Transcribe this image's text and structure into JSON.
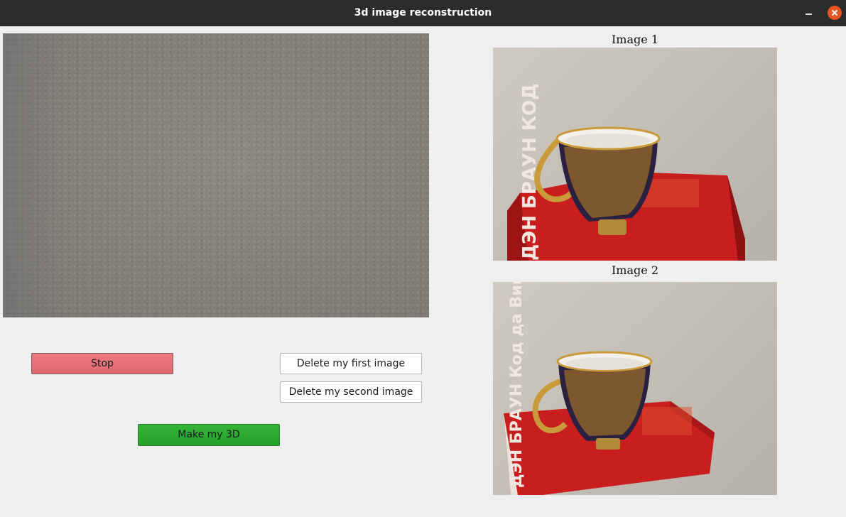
{
  "window": {
    "title": "3d image reconstruction"
  },
  "controls": {
    "stop_label": "Stop",
    "delete_first_label": "Delete my first image",
    "delete_second_label": "Delete my second image",
    "make_3d_label": "Make my 3D"
  },
  "images": {
    "image1_label": "Image 1",
    "image2_label": "Image 2",
    "image1_book_text": "ДЭН БРАУН КОД",
    "image2_book_text": "ДЭН БРАУН Код да Винчи"
  },
  "colors": {
    "titlebar": "#2c2c2c",
    "close_button": "#e9541f",
    "stop_button": "#e06870",
    "make_3d_button": "#23a128",
    "book_red": "#c81e1e"
  }
}
